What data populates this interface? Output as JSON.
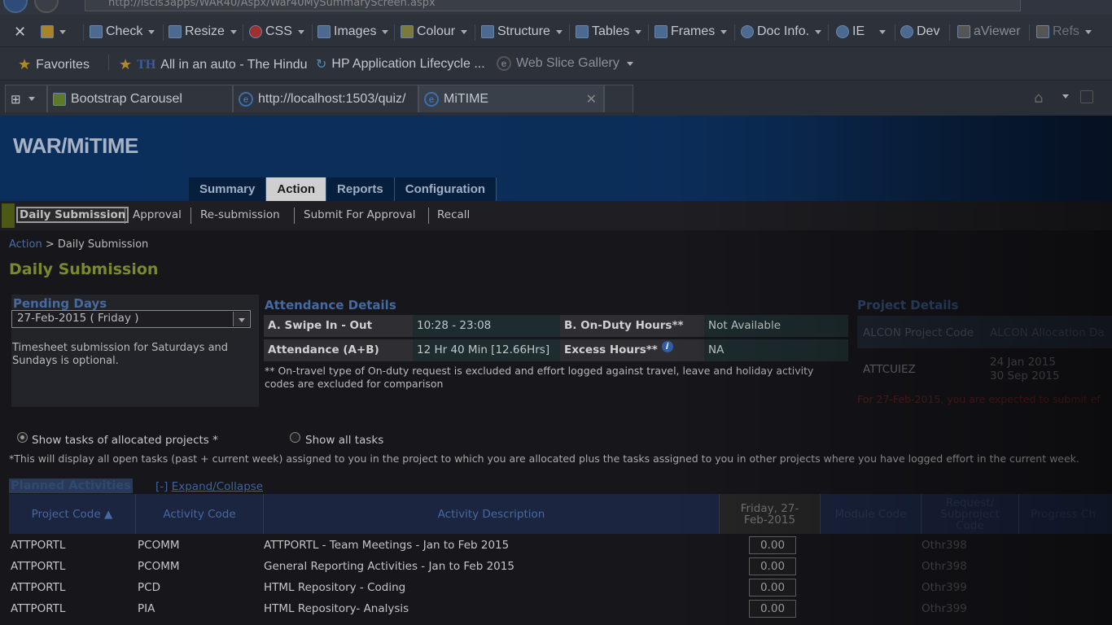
{
  "browser": {
    "address": "http://iscis3apps/WAR40/Aspx/War40MySummaryScreen.aspx",
    "toolbar": [
      {
        "label": "Check",
        "icon": "check-icon"
      },
      {
        "label": "Resize",
        "icon": "resize-icon"
      },
      {
        "label": "CSS",
        "icon": "css-icon"
      },
      {
        "label": "Images",
        "icon": "images-icon"
      },
      {
        "label": "Colour",
        "icon": "colour-icon"
      },
      {
        "label": "Structure",
        "icon": "structure-icon"
      },
      {
        "label": "Tables",
        "icon": "tables-icon"
      },
      {
        "label": "Frames",
        "icon": "frames-icon"
      },
      {
        "label": "Doc Info.",
        "icon": "info-icon"
      },
      {
        "label": "IE",
        "icon": "ie-icon"
      },
      {
        "label": "Dev",
        "icon": "dev-icon"
      },
      {
        "label": "aViewer",
        "icon": "aviewer-icon"
      },
      {
        "label": "Refs",
        "icon": "refs-icon"
      }
    ],
    "favorites_label": "Favorites",
    "favorites": [
      {
        "label": "All in an auto - The Hindu",
        "prefix": "TH"
      },
      {
        "label": "HP Application Lifecycle ..."
      },
      {
        "label": "Web Slice Gallery"
      }
    ],
    "tabs": [
      {
        "label": "Bootstrap Carousel"
      },
      {
        "label": "http://localhost:1503/quiz/"
      },
      {
        "label": "MiTIME",
        "active": true
      }
    ],
    "close_glyph": "✕"
  },
  "app": {
    "title": "WAR/MiTIME",
    "main_tabs": [
      {
        "label": "Summary"
      },
      {
        "label": "Action",
        "active": true
      },
      {
        "label": "Reports"
      },
      {
        "label": "Configuration"
      }
    ],
    "sub_nav": [
      {
        "label": "Daily Submission",
        "active": true
      },
      {
        "label": "Approval"
      },
      {
        "label": "Re-submission"
      },
      {
        "label": "Submit For Approval"
      },
      {
        "label": "Recall"
      }
    ],
    "breadcrumb": {
      "root": "Action",
      "sep": " > ",
      "current": "Daily Submission"
    },
    "heading": "Daily Submission"
  },
  "pending": {
    "title": "Pending Days",
    "selected": "27-Feb-2015 ( Friday )",
    "note": "Timesheet submission for Saturdays and Sundays is optional."
  },
  "attendance": {
    "title": "Attendance Details",
    "swipe_label": "A. Swipe In - Out",
    "swipe_value": "10:28 - 23:08",
    "onduty_label": "B. On-Duty Hours**",
    "onduty_value": "Not Available",
    "attendance_label": "Attendance (A+B)",
    "attendance_value": "12 Hr 40 Min [12.66Hrs]",
    "excess_label": "Excess Hours**",
    "excess_info": "i",
    "excess_value": "NA",
    "note": "** On-travel type of On-duty request is excluded and effort logged against travel, leave and holiday activity codes are excluded for comparison"
  },
  "project": {
    "title": "Project Details",
    "col1": "ALCON Project Code",
    "col2": "ALCON Allocation Da",
    "code": "ATTCUIEZ",
    "date1": "24 Jan 2015",
    "date2": "30 Sep 2015",
    "warning": "For 27-Feb-2015, you are expected to submit ef"
  },
  "filters": {
    "allocated_label": "Show tasks of allocated projects *",
    "all_label": "Show all tasks",
    "note": "*This will display all open tasks (past + current week) assigned to you in the project to which you are allocated plus the tasks assigned to you in other projects where you have logged effort in the current week."
  },
  "planned": {
    "title": "Planned Activities",
    "toggle": "[-]",
    "expand_label": "Expand/Collapse"
  },
  "grid": {
    "headers": {
      "project": "Project Code ▲",
      "activity": "Activity Code",
      "desc": "Activity Description",
      "day": "Friday, 27-Feb-2015",
      "module": "Module Code",
      "request": "Request/ Subproject Code",
      "progress": "Progress Ch"
    },
    "rows": [
      {
        "project": "ATTPORTL",
        "activity": "PCOMM",
        "desc": "ATTPORTL - Team Meetings - Jan to Feb 2015",
        "hours": "0.00",
        "request": "Othr398"
      },
      {
        "project": "ATTPORTL",
        "activity": "PCOMM",
        "desc": "General Reporting Activities - Jan to Feb 2015",
        "hours": "0.00",
        "request": "Othr398"
      },
      {
        "project": "ATTPORTL",
        "activity": "PCD",
        "desc": "HTML Repository - Coding",
        "hours": "0.00",
        "request": "Othr399"
      },
      {
        "project": "ATTPORTL",
        "activity": "PIA",
        "desc": "HTML Repository- Analysis",
        "hours": "0.00",
        "request": "Othr399"
      }
    ]
  }
}
